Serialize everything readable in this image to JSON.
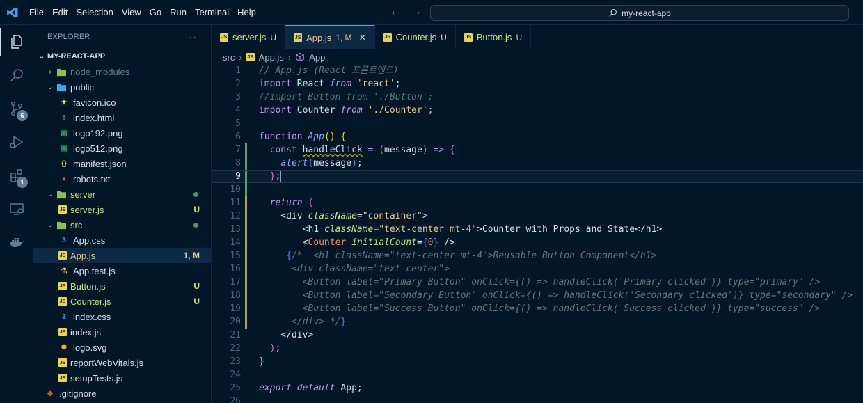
{
  "titlebar": {
    "menu": [
      "File",
      "Edit",
      "Selection",
      "View",
      "Go",
      "Run",
      "Terminal",
      "Help"
    ],
    "search_text": "my-react-app"
  },
  "activity": {
    "source_control_badge": "6",
    "extensions_badge": "1"
  },
  "sidebar": {
    "title": "EXPLORER",
    "more": "···",
    "root": "MY-REACT-APP",
    "items": [
      {
        "label": "node_modules",
        "type": "folder",
        "depth": 1,
        "collapsed": true,
        "color": "#5f7e97"
      },
      {
        "label": "public",
        "type": "folder",
        "depth": 1,
        "collapsed": false,
        "color": "#d6deeb"
      },
      {
        "label": "favicon.ico",
        "type": "file",
        "depth": 2,
        "icon": "star",
        "color": "#d6deeb"
      },
      {
        "label": "index.html",
        "type": "file",
        "depth": 2,
        "icon": "html",
        "color": "#d6deeb"
      },
      {
        "label": "logo192.png",
        "type": "file",
        "depth": 2,
        "icon": "image",
        "color": "#d6deeb"
      },
      {
        "label": "logo512.png",
        "type": "file",
        "depth": 2,
        "icon": "image",
        "color": "#d6deeb"
      },
      {
        "label": "manifest.json",
        "type": "file",
        "depth": 2,
        "icon": "json",
        "color": "#d6deeb"
      },
      {
        "label": "robots.txt",
        "type": "file",
        "depth": 2,
        "icon": "robot",
        "color": "#d6deeb"
      },
      {
        "label": "server",
        "type": "folder",
        "depth": 1,
        "collapsed": false,
        "color": "#c5e478",
        "dot": true
      },
      {
        "label": "server.js",
        "type": "file",
        "depth": 2,
        "icon": "js",
        "color": "#c5e478",
        "status": "U",
        "status_color": "#c5e478"
      },
      {
        "label": "src",
        "type": "folder",
        "depth": 1,
        "collapsed": false,
        "color": "#c5e478",
        "dot": true
      },
      {
        "label": "App.css",
        "type": "file",
        "depth": 2,
        "icon": "css",
        "color": "#d6deeb"
      },
      {
        "label": "App.js",
        "type": "file",
        "depth": 2,
        "icon": "js",
        "color": "#ecc48d",
        "status": "1, M",
        "status_color": "#ecc48d",
        "selected": true
      },
      {
        "label": "App.test.js",
        "type": "file",
        "depth": 2,
        "icon": "flask",
        "color": "#d6deeb"
      },
      {
        "label": "Button.js",
        "type": "file",
        "depth": 2,
        "icon": "js",
        "color": "#c5e478",
        "status": "U",
        "status_color": "#c5e478"
      },
      {
        "label": "Counter.js",
        "type": "file",
        "depth": 2,
        "icon": "js",
        "color": "#c5e478",
        "status": "U",
        "status_color": "#c5e478"
      },
      {
        "label": "index.css",
        "type": "file",
        "depth": 2,
        "icon": "css",
        "color": "#d6deeb"
      },
      {
        "label": "index.js",
        "type": "file",
        "depth": 2,
        "icon": "js",
        "color": "#d6deeb"
      },
      {
        "label": "logo.svg",
        "type": "file",
        "depth": 2,
        "icon": "svg",
        "color": "#d6deeb"
      },
      {
        "label": "reportWebVitals.js",
        "type": "file",
        "depth": 2,
        "icon": "js",
        "color": "#d6deeb"
      },
      {
        "label": "setupTests.js",
        "type": "file",
        "depth": 2,
        "icon": "js",
        "color": "#d6deeb"
      },
      {
        "label": ".gitignore",
        "type": "file",
        "depth": 1,
        "icon": "git",
        "color": "#d6deeb"
      }
    ]
  },
  "tabs": [
    {
      "label": "server.js",
      "status": "U",
      "color": "#c5e478",
      "active": false
    },
    {
      "label": "App.js",
      "status": "1, M",
      "color": "#ecc48d",
      "active": true,
      "close": "✕"
    },
    {
      "label": "Counter.js",
      "status": "U",
      "color": "#c5e478",
      "active": false
    },
    {
      "label": "Button.js",
      "status": "U",
      "color": "#c5e478",
      "active": false
    }
  ],
  "breadcrumb": {
    "folder": "src",
    "file": "App.js",
    "symbol": "App"
  },
  "editor": {
    "current_line": 9,
    "lines": [
      {
        "n": "1",
        "g": "",
        "t": [
          [
            "// App.js (React 프론트엔드)",
            "cm"
          ]
        ]
      },
      {
        "n": "2",
        "g": "",
        "t": [
          [
            "import",
            "kwn"
          ],
          [
            " React ",
            "var"
          ],
          [
            "from",
            "kw"
          ],
          [
            " ",
            "var"
          ],
          [
            "'react'",
            "str"
          ],
          [
            ";",
            "var"
          ]
        ]
      },
      {
        "n": "3",
        "g": "",
        "t": [
          [
            "//import Button from './Button';",
            "cm"
          ]
        ]
      },
      {
        "n": "4",
        "g": "",
        "t": [
          [
            "import",
            "kwn"
          ],
          [
            " Counter ",
            "var"
          ],
          [
            "from",
            "kw"
          ],
          [
            " ",
            "var"
          ],
          [
            "'./Counter'",
            "str"
          ],
          [
            ";",
            "var"
          ]
        ]
      },
      {
        "n": "5",
        "g": "",
        "t": []
      },
      {
        "n": "6",
        "g": "",
        "t": [
          [
            "function",
            "kwn"
          ],
          [
            " ",
            "var"
          ],
          [
            "App",
            "fn"
          ],
          [
            "()",
            "brk"
          ],
          [
            " ",
            "var"
          ],
          [
            "{",
            "brk"
          ]
        ]
      },
      {
        "n": "7",
        "g": "#5a9e6f",
        "t": [
          [
            "  const ",
            "kwn"
          ],
          [
            "handleClick",
            "sq"
          ],
          [
            " = ",
            "pun"
          ],
          [
            "(",
            "brk2"
          ],
          [
            "message",
            "param"
          ],
          [
            ")",
            "brk2"
          ],
          [
            " => ",
            "pun"
          ],
          [
            "{",
            "brk2"
          ]
        ]
      },
      {
        "n": "8",
        "g": "#5a9e6f",
        "t": [
          [
            "    ",
            "var"
          ],
          [
            "alert",
            "fn"
          ],
          [
            "(",
            "brk3"
          ],
          [
            "message",
            "var"
          ],
          [
            ")",
            "brk3"
          ],
          [
            ";",
            "var"
          ]
        ]
      },
      {
        "n": "9",
        "g": "#5a9e6f",
        "t": [
          [
            "  ",
            "var"
          ],
          [
            "}",
            "brk2"
          ],
          [
            ";",
            "var"
          ]
        ]
      },
      {
        "n": "10",
        "g": "#5a9e6f",
        "t": []
      },
      {
        "n": "11",
        "g": "#a9a05f",
        "t": [
          [
            "  ",
            "var"
          ],
          [
            "return",
            "kw"
          ],
          [
            " ",
            "var"
          ],
          [
            "(",
            "brk2"
          ]
        ]
      },
      {
        "n": "12",
        "g": "#a9a05f",
        "t": [
          [
            "    <",
            "tag"
          ],
          [
            "div",
            "tag"
          ],
          [
            " ",
            "var"
          ],
          [
            "className",
            "attr"
          ],
          [
            "=",
            "var"
          ],
          [
            "\"container\"",
            "str"
          ],
          [
            ">",
            "tag"
          ]
        ]
      },
      {
        "n": "13",
        "g": "#a9a05f",
        "t": [
          [
            "        <",
            "tag"
          ],
          [
            "h1",
            "tag"
          ],
          [
            " ",
            "var"
          ],
          [
            "className",
            "attr"
          ],
          [
            "=",
            "var"
          ],
          [
            "\"text-center mt-4\"",
            "str"
          ],
          [
            ">Counter with Props and State</",
            "var"
          ],
          [
            "h1",
            "tag"
          ],
          [
            ">",
            "tag"
          ]
        ]
      },
      {
        "n": "14",
        "g": "#a9a05f",
        "t": [
          [
            "        <",
            "tag"
          ],
          [
            "Counter",
            "comp"
          ],
          [
            " ",
            "var"
          ],
          [
            "initialCount",
            "attr"
          ],
          [
            "=",
            "var"
          ],
          [
            "{",
            "brk3"
          ],
          [
            "0",
            "num"
          ],
          [
            "}",
            "brk3"
          ],
          [
            " />",
            "tag"
          ]
        ]
      },
      {
        "n": "15",
        "g": "#a9a05f",
        "t": [
          [
            "     ",
            "var"
          ],
          [
            "{",
            "brk3"
          ],
          [
            "/*  <h1 className=\"text-center mt-4\">Reusable Button Component</h1>",
            "dim"
          ]
        ]
      },
      {
        "n": "16",
        "g": "#a9a05f",
        "t": [
          [
            "      <div className=\"text-center\">",
            "dim"
          ]
        ]
      },
      {
        "n": "17",
        "g": "#a9a05f",
        "t": [
          [
            "        <Button label=\"Primary Button\" onClick={() => handleClick('Primary clicked')} type=\"primary\" />",
            "dim"
          ]
        ]
      },
      {
        "n": "18",
        "g": "#a9a05f",
        "t": [
          [
            "        <Button label=\"Secondary Button\" onClick={() => handleClick('Secondary clicked')} type=\"secondary\" />",
            "dim"
          ]
        ]
      },
      {
        "n": "19",
        "g": "#a9a05f",
        "t": [
          [
            "        <Button label=\"Success Button\" onClick={() => handleClick('Success clicked')} type=\"success\" />",
            "dim"
          ]
        ]
      },
      {
        "n": "20",
        "g": "#a9a05f",
        "t": [
          [
            "      </div> */",
            "dim"
          ],
          [
            "}",
            "brk3"
          ]
        ]
      },
      {
        "n": "21",
        "g": "",
        "t": [
          [
            "    </",
            "tag"
          ],
          [
            "div",
            "tag"
          ],
          [
            ">",
            "tag"
          ]
        ]
      },
      {
        "n": "22",
        "g": "",
        "t": [
          [
            "  ",
            "var"
          ],
          [
            ")",
            "brk2"
          ],
          [
            ";",
            "var"
          ]
        ]
      },
      {
        "n": "23",
        "g": "",
        "t": [
          [
            "}",
            "brk"
          ]
        ]
      },
      {
        "n": "24",
        "g": "",
        "t": []
      },
      {
        "n": "25",
        "g": "",
        "t": [
          [
            "export",
            "kw"
          ],
          [
            " ",
            "var"
          ],
          [
            "default",
            "kw"
          ],
          [
            " App;",
            "var"
          ]
        ]
      },
      {
        "n": "26",
        "g": "",
        "t": []
      }
    ]
  },
  "colors": {
    "background": "#011627",
    "accent": "#21c7a8",
    "untracked": "#c5e478",
    "modified": "#ecc48d"
  }
}
